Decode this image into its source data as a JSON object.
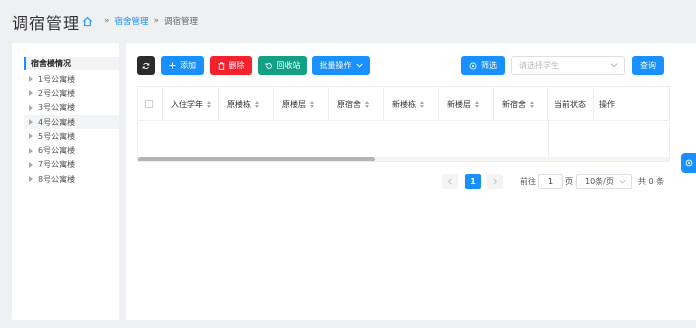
{
  "header": {
    "title": "调宿管理",
    "breadcrumb": [
      "宿舍管理",
      "调宿管理"
    ],
    "separator": "»"
  },
  "tree": {
    "root": "宿舍楼情况",
    "nodes": [
      "1号公寓楼",
      "2号公寓楼",
      "3号公寓楼",
      "4号公寓楼",
      "5号公寓楼",
      "6号公寓楼",
      "7号公寓楼",
      "8号公寓楼"
    ],
    "active_index": 3
  },
  "toolbar": {
    "add": "添加",
    "delete": "删除",
    "recycle": "回收站",
    "batch": "批量操作",
    "filter": "筛选",
    "student_placeholder": "请选择学生",
    "query": "查询"
  },
  "table": {
    "columns": [
      "入住学年",
      "原楼栋",
      "原楼层",
      "原宿舍",
      "新楼栋",
      "新楼层",
      "新宿舍",
      "当前状态",
      "操作"
    ],
    "rows": []
  },
  "pagination": {
    "current_page": "1",
    "goto_label": "前往",
    "goto_value": "1",
    "page_unit": "页",
    "page_size": "10条/页",
    "total": "共 0 条"
  },
  "colors": {
    "primary": "#1890ff",
    "danger": "#f5222d",
    "success": "#13a084",
    "dark": "#2b2b2b"
  }
}
